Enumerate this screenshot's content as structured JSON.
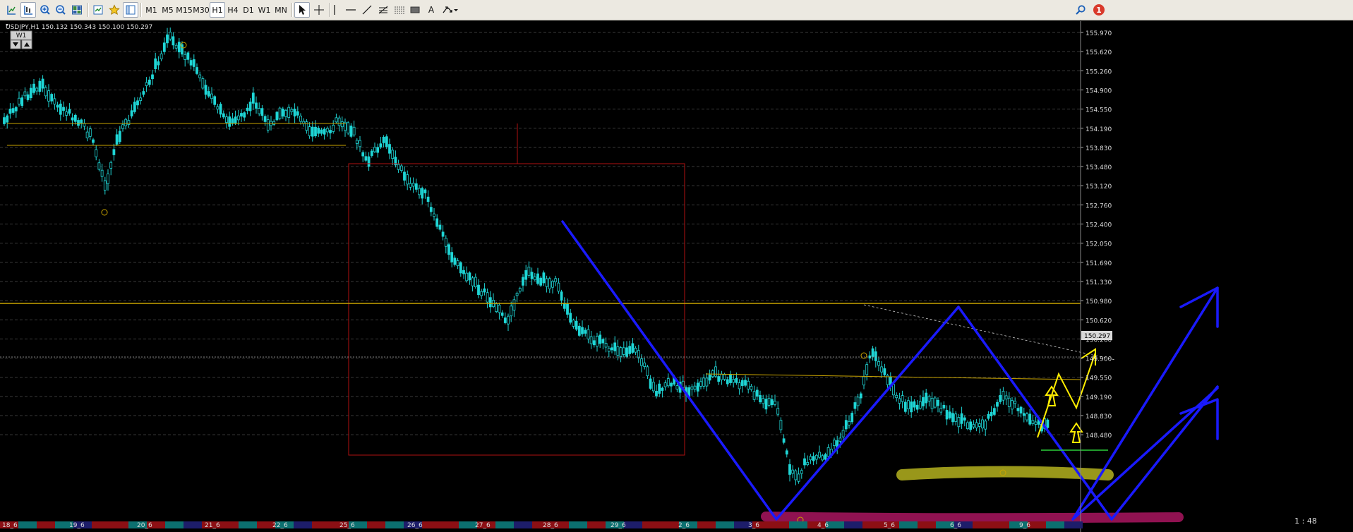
{
  "toolbar": {
    "tools_left": [
      "new-chart-icon",
      "line-studio-icon",
      "zoom-in-icon",
      "zoom-out-icon",
      "tile-windows-icon"
    ],
    "tools_mid": [
      "navigator-icon",
      "favorites-icon",
      "data-window-icon"
    ],
    "timeframes": [
      "M1",
      "M5",
      "M15",
      "M30",
      "H1",
      "H4",
      "D1",
      "W1",
      "MN"
    ],
    "active_timeframe": "H1",
    "drawing_tools": [
      "cursor-icon",
      "crosshair-icon",
      "vertical-line-icon",
      "horizontal-line-icon",
      "trendline-icon",
      "fibonacci-icon",
      "channel-icon",
      "rectangle-icon",
      "text-icon",
      "arrow-tools-icon"
    ],
    "text_tool_label": "A",
    "notification_count": "1"
  },
  "chart": {
    "header": "USDJPY,H1  150.132 150.343 150.100 150.297",
    "period_badge": "W1",
    "price_axis": [
      "155.970",
      "155.620",
      "155.260",
      "154.900",
      "154.550",
      "154.190",
      "153.830",
      "153.480",
      "153.120",
      "152.760",
      "152.400",
      "152.050",
      "151.690",
      "151.330",
      "150.980",
      "150.620",
      "150.260",
      "149.900",
      "149.550",
      "149.190",
      "148.830",
      "148.480"
    ],
    "current_price": "150.297",
    "time_axis": [
      "18_6",
      "19_6",
      "20_6",
      "21_6",
      "22_6",
      "25_6",
      "26_6",
      "27_6",
      "28_6",
      "29_6",
      "2_6",
      "3_6",
      "4_6",
      "5_6",
      "6_6",
      "9_6"
    ],
    "ratio_label": "1 : 48",
    "colors": {
      "background": "#000000",
      "candles": "#1fd6d6",
      "grid": "#3a3a3a",
      "level_lines": "#c9a400",
      "zone_rect": "#b01010",
      "forecast_lines": "#1a1aff",
      "arrows": "#ffee00",
      "support_highlight": "#b4b21e",
      "bottom_highlight": "#a0145a"
    }
  }
}
